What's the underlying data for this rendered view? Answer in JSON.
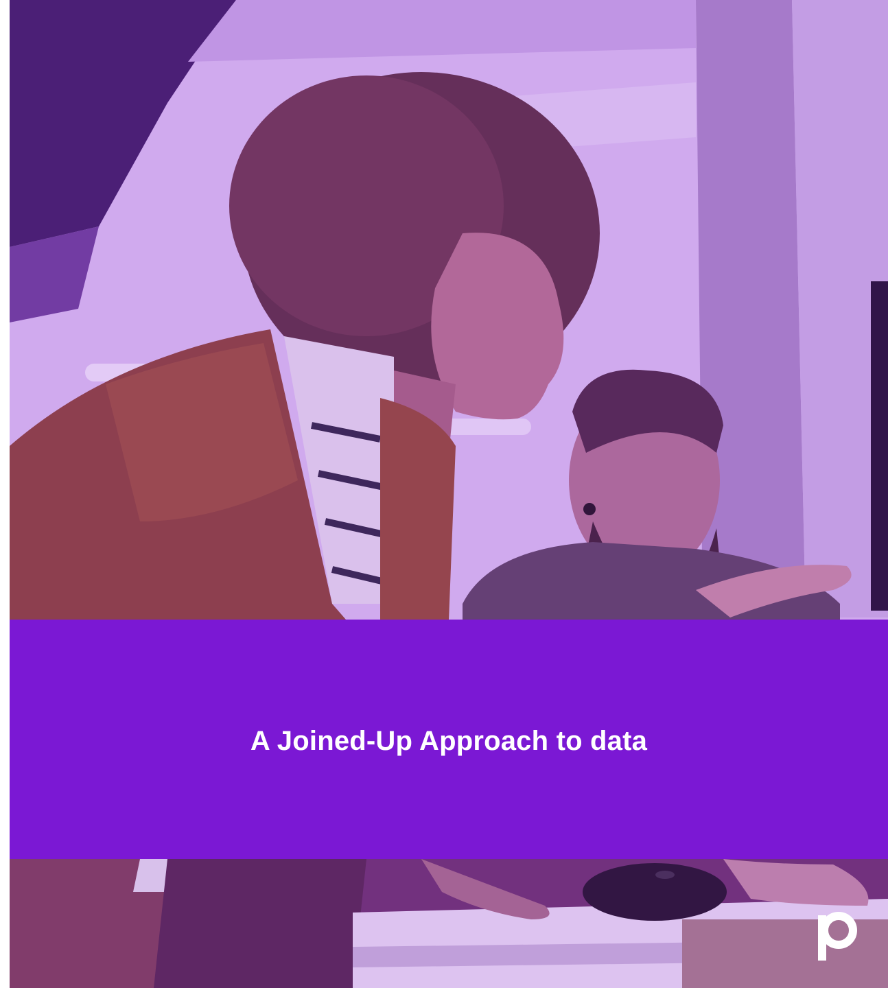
{
  "hero_image": {
    "subject": "photo-two-colleagues-at-computer",
    "tint_color": "#9b46dc"
  },
  "title_band": {
    "title": "A Joined-Up Approach to data",
    "background_color": "#7c16de"
  },
  "brand": {
    "logo_icon": "p-logo-icon",
    "logo_color": "#ffffff"
  }
}
